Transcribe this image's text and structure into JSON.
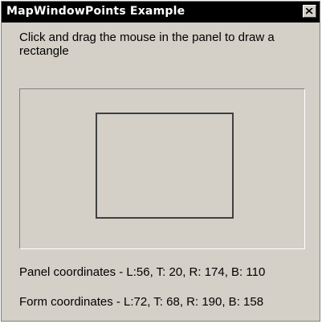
{
  "window": {
    "title": "MapWindowPoints Example"
  },
  "instructions": "Click and drag the mouse in the panel to draw a rectangle",
  "panel_coordinates": "Panel coordinates - L:56, T: 20, R: 174, B: 110",
  "form_coordinates": "Form coordinates - L:72, T: 68, R: 190, B: 158",
  "icons": {
    "close": "close-icon"
  },
  "colors": {
    "titlebar": "#000000",
    "window_bg": "#d4d0c8",
    "rect_stroke": "#404040"
  }
}
